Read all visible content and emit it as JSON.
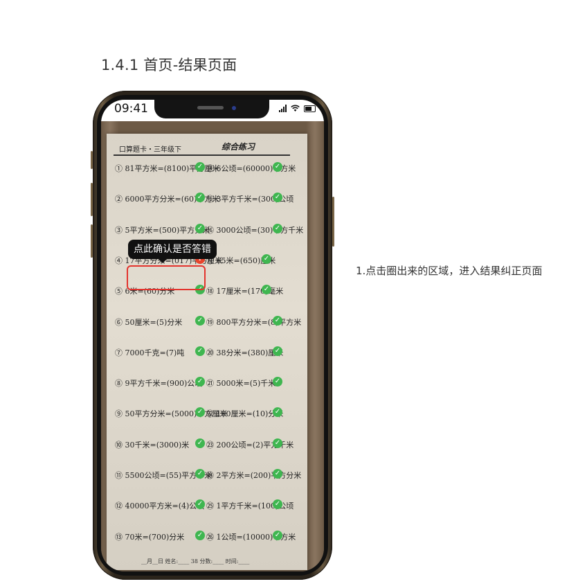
{
  "section_title": "1.4.1 首页-结果页面",
  "annotation": "1.点击圈出来的区域，进入结果纠正页面",
  "status_bar": {
    "time": "09:41"
  },
  "worksheet": {
    "header_left": "口算题卡・三年级下",
    "header_right": "综合练习",
    "rows": [
      {
        "left": "① 81平方米=(8100)平方厘米",
        "right": "⑭ 6公顷=(60000)平方米"
      },
      {
        "left": "② 6000平方分米=(60)平方米",
        "right": "⑮ 3平方千米=(300)公顷"
      },
      {
        "left": "③ 5平方米=(500)平方分米",
        "right": "⑯ 3000公顷=(30)平方千米"
      },
      {
        "left": "④ 17平方分米=(017)平方厘米",
        "right": "⑰ 65米=(650)厘米"
      },
      {
        "left": "⑤ 6米=(60)分米",
        "right": "⑱ 17厘米=(170)毫米"
      },
      {
        "left": "⑥ 50厘米=(5)分米",
        "right": "⑲ 800平方分米=(8)平方米"
      },
      {
        "left": "⑦ 7000千克=(7)吨",
        "right": "⑳ 38分米=(380)厘米"
      },
      {
        "left": "⑧ 9平方千米=(900)公顷",
        "right": "㉑ 5000米=(5)千米"
      },
      {
        "left": "⑨ 50平方分米=(5000)平方厘米",
        "right": "㉒ 100厘米=(10)分米"
      },
      {
        "left": "⑩ 30千米=(3000)米",
        "right": "㉓ 200公顷=(2)平方千米"
      },
      {
        "left": "⑪ 5500公顷=(55)平方千米",
        "right": "㉔ 2平方米=(200)平方分米"
      },
      {
        "left": "⑫ 40000平方米=(4)公顷",
        "right": "㉕ 1平方千米=(100)公顷"
      },
      {
        "left": "⑬ 70米=(700)分米",
        "right": "㉖ 1公顷=(10000)平方米"
      }
    ],
    "footer": "__月__日 姓名:____   38   分数:____ 时间:____"
  },
  "tooltip": "点此确认是否答错",
  "marks": {
    "correct": "✓",
    "wrong": "?"
  }
}
